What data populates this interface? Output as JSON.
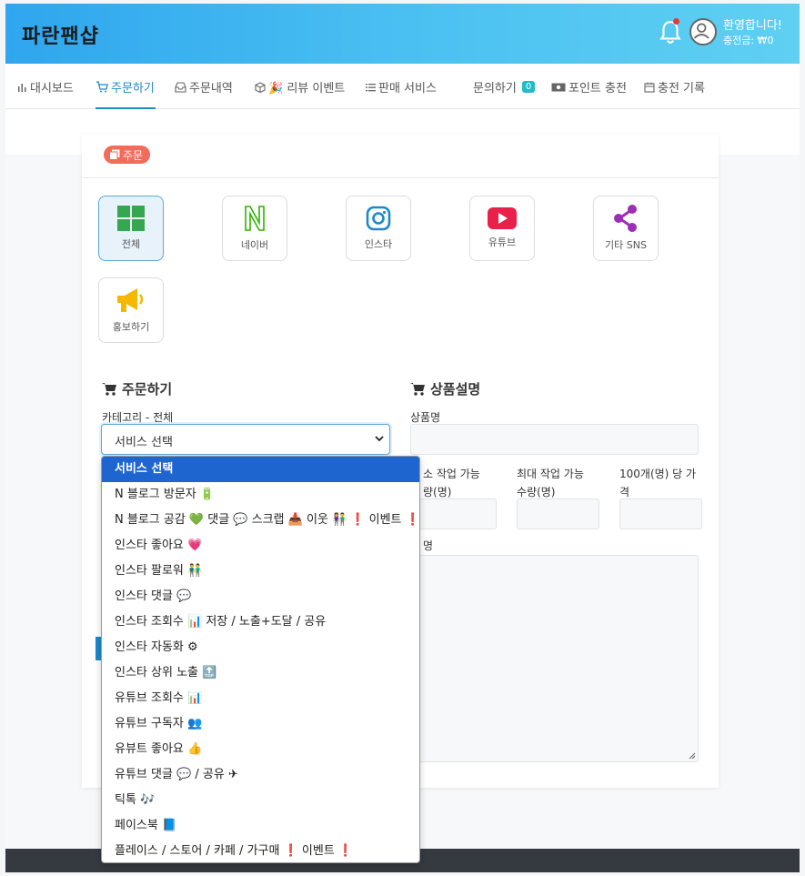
{
  "app": {
    "brand": "파란팬샵",
    "welcome": "환영합니다!",
    "balance": "충전금: ₩0"
  },
  "nav": {
    "items": [
      {
        "label": "대시보드",
        "icon": "bar-chart-icon"
      },
      {
        "label": "주문하기",
        "icon": "cart-icon",
        "active": true
      },
      {
        "label": "주문내역",
        "icon": "inbox-icon"
      },
      {
        "label": "🎉 리뷰 이벤트",
        "icon": "box-icon"
      },
      {
        "label": "판매 서비스",
        "icon": "list-icon"
      },
      {
        "label": "문의하기",
        "badge": "0"
      },
      {
        "label": "포인트 충전",
        "icon": "money-icon"
      },
      {
        "label": "충전 기록",
        "icon": "calendar-icon"
      }
    ]
  },
  "order_badge": "주문",
  "categories": [
    {
      "label": "전체",
      "icon": "grid-icon",
      "selected": true
    },
    {
      "label": "네이버",
      "icon": "naver-icon"
    },
    {
      "label": "인스타",
      "icon": "instagram-icon"
    },
    {
      "label": "유튜브",
      "icon": "youtube-icon"
    },
    {
      "label": "기타 SNS",
      "icon": "share-icon"
    },
    {
      "label": "홍보하기",
      "icon": "megaphone-icon"
    }
  ],
  "order_section": {
    "title": "주문하기",
    "category_label": "카테고리 - 전체",
    "select_value": "서비스 선택"
  },
  "product_section": {
    "title": "상품설명",
    "name_label": "상품명",
    "min_label_l1": "소 작업 가능",
    "min_label_l2": "량(명)",
    "max_label_l1": "최대 작업 가능",
    "max_label_l2": "수량(명)",
    "price_label_l1": "100개(명) 당 가",
    "price_label_l2": "격",
    "desc_label": "명"
  },
  "dropdown": {
    "options": [
      "서비스 선택",
      "N 블로그 방문자 🔋",
      "N 블로그 공감 💚 댓글 💬 스크랩 📥 이웃 👫 ❗ 이벤트 ❗",
      "인스타 좋아요 💗",
      "인스타 팔로워 👬",
      "인스타 댓글 💬",
      "인스타 조회수 📊 저장 / 노출+도달 / 공유",
      "인스타 자동화 ⚙",
      "인스타 상위 노출 🔝",
      "유튜브 조회수 📊",
      "유튜브 구독자 👥",
      "유뷰트 좋아요 👍",
      "유튜브 댓글 💬 / 공유 ✈",
      "틱톡 🎶",
      "페이스북 📘",
      "플레이스 / 스토어 / 카페 / 가구매 ❗ 이벤트 ❗"
    ]
  },
  "colors": {
    "header_start": "#2fa6ee",
    "accent": "#1e88c9",
    "badge_red": "#f26b5b",
    "selected_option": "#1e65cf",
    "footer": "#343a40"
  }
}
